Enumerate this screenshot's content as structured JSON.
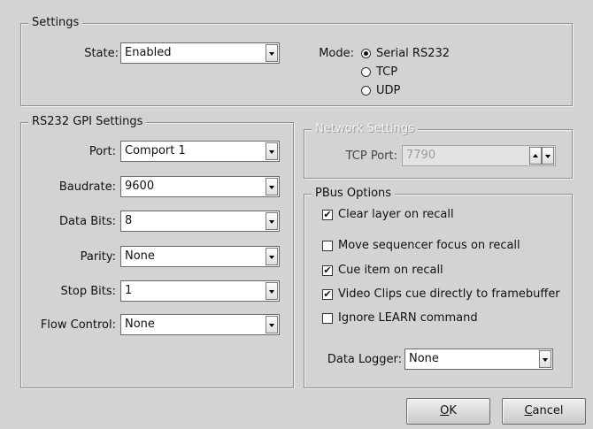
{
  "settings": {
    "title": "Settings",
    "state_label": "State:",
    "state_value": "Enabled",
    "mode_label": "Mode:",
    "modes": [
      {
        "label": "Serial RS232",
        "selected": true
      },
      {
        "label": "TCP",
        "selected": false
      },
      {
        "label": "UDP",
        "selected": false
      }
    ]
  },
  "rs232": {
    "title": "RS232 GPI Settings",
    "fields": [
      {
        "label": "Port:",
        "value": "Comport 1"
      },
      {
        "label": "Baudrate:",
        "value": "9600"
      },
      {
        "label": "Data Bits:",
        "value": "8"
      },
      {
        "label": "Parity:",
        "value": "None"
      },
      {
        "label": "Stop Bits:",
        "value": "1"
      },
      {
        "label": "Flow Control:",
        "value": "None"
      }
    ]
  },
  "network": {
    "title": "Network Settings",
    "tcp_port_label": "TCP Port:",
    "tcp_port_value": "7790",
    "enabled": false
  },
  "pbus": {
    "title": "PBus Options",
    "options": [
      {
        "label": "Clear layer on recall",
        "checked": true
      },
      {
        "label": "Move sequencer focus on recall",
        "checked": false
      },
      {
        "label": "Cue item on recall",
        "checked": true
      },
      {
        "label": "Video Clips cue directly to framebuffer",
        "checked": true
      },
      {
        "label": "Ignore LEARN command",
        "checked": false
      }
    ],
    "data_logger_label": "Data Logger:",
    "data_logger_value": "None"
  },
  "buttons": {
    "ok_accel": "O",
    "ok_rest": "K",
    "cancel_accel": "C",
    "cancel_rest": "ancel"
  },
  "check_mark": "✔"
}
